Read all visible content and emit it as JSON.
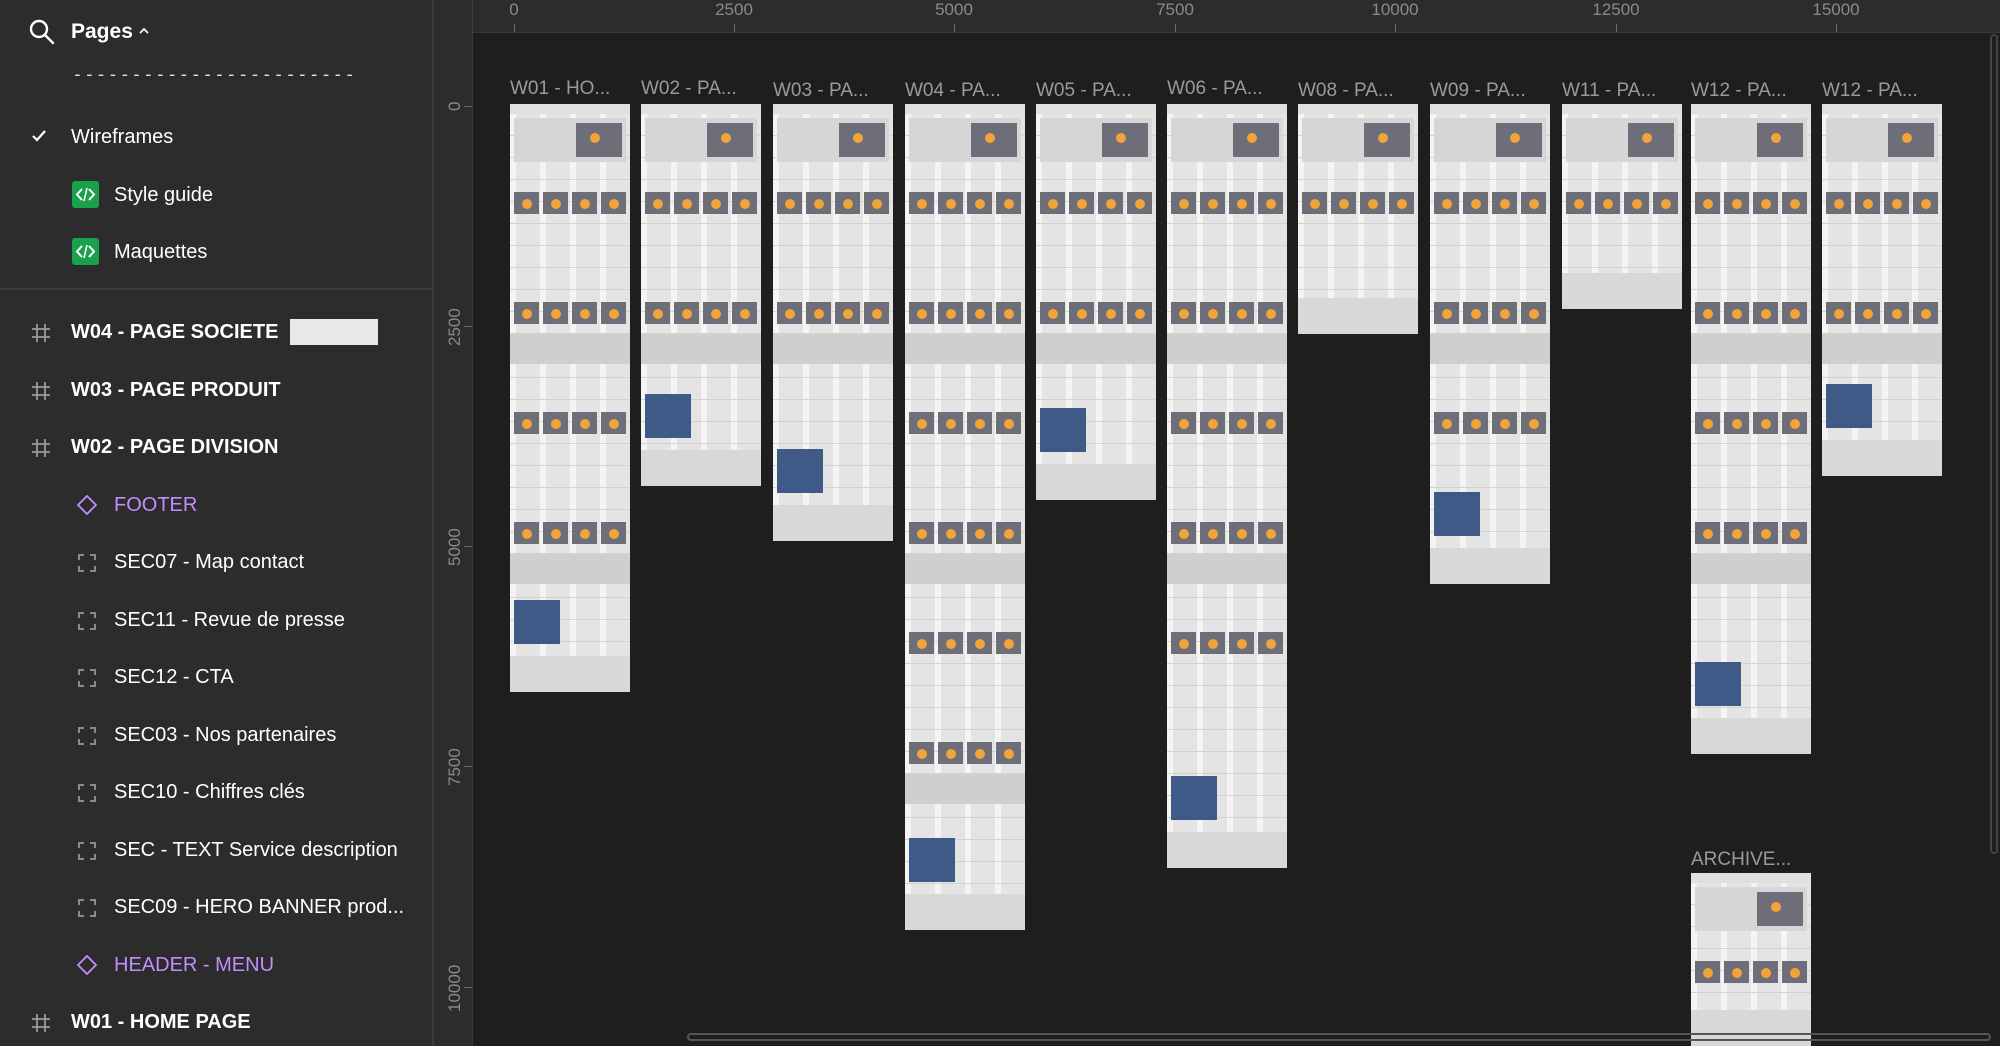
{
  "sidebar": {
    "pages_title": "Pages",
    "separator": "------------------------",
    "pages": [
      {
        "label": "Wireframes",
        "checked": true
      },
      {
        "label": "Style guide"
      },
      {
        "label": "Maquettes"
      }
    ],
    "layers": [
      {
        "label": "W04 - PAGE SOCIETE",
        "type": "frame"
      },
      {
        "label": "W03 - PAGE PRODUIT",
        "type": "frame"
      },
      {
        "label": "W02 - PAGE DIVISION",
        "type": "frame"
      },
      {
        "label": "FOOTER",
        "type": "component"
      },
      {
        "label": "SEC07 - Map contact",
        "type": "section"
      },
      {
        "label": "SEC11 - Revue de presse",
        "type": "section"
      },
      {
        "label": "SEC12 - CTA",
        "type": "section"
      },
      {
        "label": "SEC03 - Nos partenaires",
        "type": "section"
      },
      {
        "label": "SEC10 - Chiffres clés",
        "type": "section"
      },
      {
        "label": "SEC - TEXT Service description",
        "type": "section"
      },
      {
        "label": "SEC09 - HERO BANNER prod...",
        "type": "section"
      },
      {
        "label": "HEADER - MENU",
        "type": "component"
      },
      {
        "label": "W01 - HOME PAGE",
        "type": "frame"
      }
    ]
  },
  "canvas": {
    "ruler_x": [
      "0",
      "2500",
      "5000",
      "7500",
      "10000",
      "12500",
      "15000"
    ],
    "ruler_y": [
      "0",
      "2500",
      "5000",
      "7500",
      "10000"
    ],
    "frames": [
      {
        "title": "W01 - HO..."
      },
      {
        "title": "W02 - PA..."
      },
      {
        "title": "W03 - PA..."
      },
      {
        "title": "W04 - PA..."
      },
      {
        "title": "W05 - PA..."
      },
      {
        "title": "W06 - PA..."
      },
      {
        "title": "W08 - PA..."
      },
      {
        "title": "W09 - PA..."
      },
      {
        "title": "W11 - PA..."
      },
      {
        "title": "W12 - PA..."
      },
      {
        "title": "W12 - PA..."
      },
      {
        "title": "ARCHIVE..."
      }
    ]
  },
  "colors": {
    "sidebar_bg": "#2c2c2c",
    "canvas_bg": "#1e1e1e",
    "component_purple": "#c48dff",
    "code_green": "#19a14b"
  }
}
